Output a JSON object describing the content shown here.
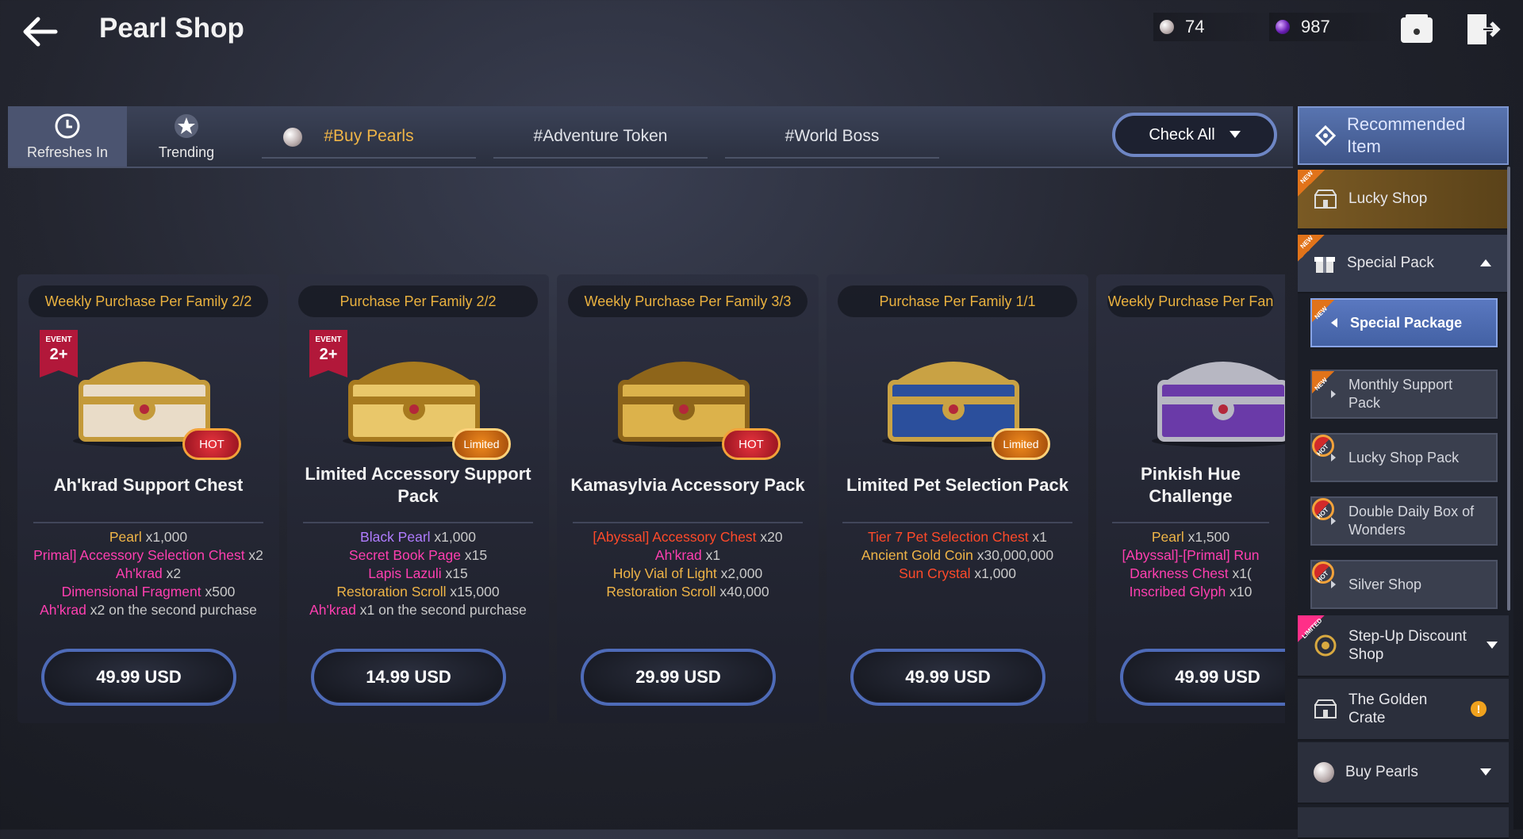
{
  "header": {
    "title": "Pearl Shop",
    "pearl_count": "74",
    "black_pearl_count": "987"
  },
  "tabs": {
    "refresh_label": "Refreshes In",
    "trending_label": "Trending",
    "hashtags": [
      "#Buy Pearls",
      "#Adventure Token",
      "#World Boss"
    ],
    "check_all": "Check All"
  },
  "cards": [
    {
      "limit": "Weekly Purchase Per Family 2/2",
      "name": "Ah'krad Support Chest",
      "badge": "EVENT",
      "badge_num": "2+",
      "tag": "HOT",
      "lines": [
        {
          "name": "Pearl",
          "qty": " x1,000",
          "color": "#f0b547"
        },
        {
          "name": "Primal] Accessory Selection Chest",
          "qty": " x2",
          "color": "#ff3fb0"
        },
        {
          "name": "Ah'krad",
          "qty": " x2",
          "color": "#ff3fb0"
        },
        {
          "name": "Dimensional Fragment",
          "qty": " x500",
          "color": "#ff3fb0"
        },
        {
          "name": "Ah'krad",
          "qty": " x2 on the second purchase",
          "color": "#ff3fb0"
        }
      ],
      "price": "49.99 USD"
    },
    {
      "limit": "Purchase Per Family 2/2",
      "name": "Limited Accessory Support Pack",
      "badge": "EVENT",
      "badge_num": "2+",
      "tag": "Limited",
      "lines": [
        {
          "name": "Black Pearl",
          "qty": " x1,000",
          "color": "#b07cff"
        },
        {
          "name": "Secret Book Page",
          "qty": " x15",
          "color": "#ff3fb0"
        },
        {
          "name": "Lapis Lazuli",
          "qty": " x15",
          "color": "#ff3fb0"
        },
        {
          "name": "Restoration Scroll",
          "qty": " x15,000",
          "color": "#f0b547"
        },
        {
          "name": "Ah'krad",
          "qty": " x1 on the second purchase",
          "color": "#ff3fb0"
        }
      ],
      "price": "14.99 USD"
    },
    {
      "limit": "Weekly Purchase Per Family 3/3",
      "name": "Kamasylvia Accessory Pack",
      "badge": "",
      "badge_num": "",
      "tag": "HOT",
      "lines": [
        {
          "name": "[Abyssal] Accessory Chest",
          "qty": " x20",
          "color": "#ff4a2a"
        },
        {
          "name": "Ah'krad",
          "qty": " x1",
          "color": "#ff3fb0"
        },
        {
          "name": "Holy Vial of Light",
          "qty": " x2,000",
          "color": "#f0b547"
        },
        {
          "name": "Restoration Scroll",
          "qty": " x40,000",
          "color": "#f0b547"
        }
      ],
      "price": "29.99 USD"
    },
    {
      "limit": "Purchase Per Family 1/1",
      "name": "Limited Pet Selection Pack",
      "badge": "",
      "badge_num": "",
      "tag": "Limited",
      "lines": [
        {
          "name": "Tier 7 Pet Selection Chest",
          "qty": " x1",
          "color": "#ff4a2a"
        },
        {
          "name": "Ancient Gold Coin",
          "qty": " x30,000,000",
          "color": "#f0b547"
        },
        {
          "name": "Sun Crystal",
          "qty": " x1,000",
          "color": "#ff4a2a"
        }
      ],
      "price": "49.99 USD"
    },
    {
      "limit": "Weekly Purchase Per Fan",
      "name": "Pinkish Hue Challenge",
      "badge": "",
      "badge_num": "",
      "tag": "",
      "lines": [
        {
          "name": "Pearl",
          "qty": " x1,500",
          "color": "#f0b547"
        },
        {
          "name": "[Abyssal]-[Primal] Run",
          "qty": "",
          "color": "#ff3fb0"
        },
        {
          "name": "Darkness Chest",
          "qty": " x1(",
          "color": "#ff3fb0"
        },
        {
          "name": "Inscribed Glyph",
          "qty": " x10",
          "color": "#ff3fb0"
        }
      ],
      "price": "49.99 USD"
    }
  ],
  "sidebar": {
    "recommended": "Recommended Item",
    "lucky_shop": "Lucky Shop",
    "special_pack": "Special Pack",
    "special_package": "Special Package",
    "monthly_support": "Monthly Support Pack",
    "lucky_shop_pack": "Lucky Shop Pack",
    "double_daily": "Double Daily Box of Wonders",
    "silver_shop": "Silver Shop",
    "step_up": "Step-Up Discount Shop",
    "golden_crate": "The Golden Crate",
    "buy_pearls": "Buy Pearls",
    "ribbon_new": "NEW",
    "ribbon_hot": "HOT",
    "ribbon_limited": "LIMITED",
    "alert": "!"
  },
  "colors": {
    "accent_gold": "#f0b547",
    "pink_item": "#ff3fb0",
    "red_item": "#ff4a2a",
    "purple_item": "#b07cff",
    "price_border": "#4e6bb8"
  }
}
